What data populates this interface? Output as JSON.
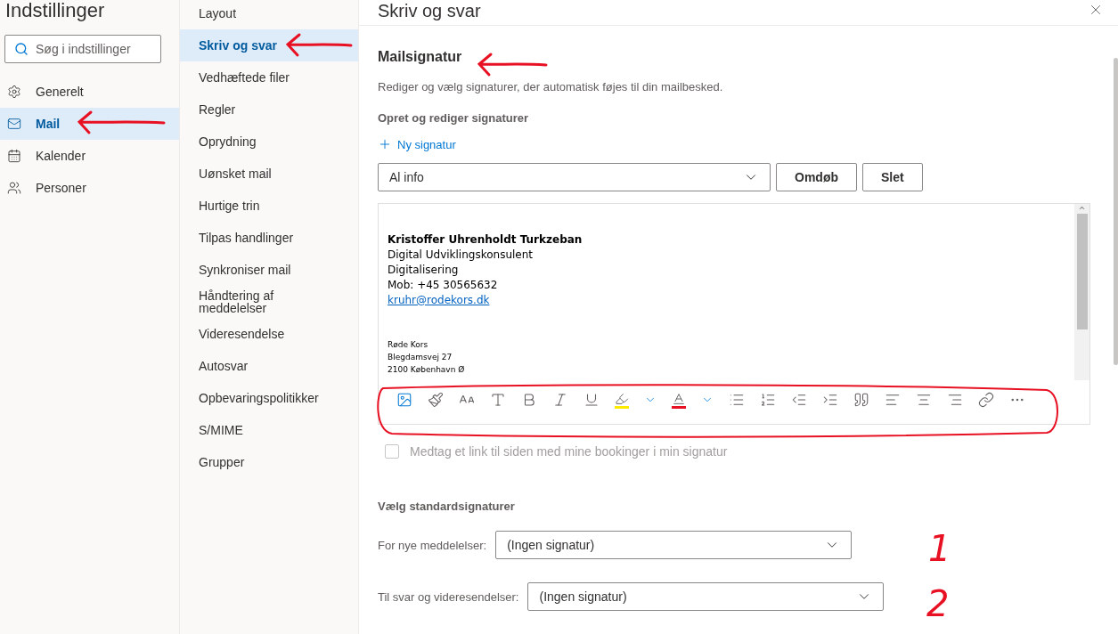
{
  "sidebar": {
    "title": "Indstillinger",
    "search": {
      "placeholder": "Søg i indstillinger"
    },
    "items": [
      {
        "label": "Generelt",
        "kind": "gear",
        "selected": false
      },
      {
        "label": "Mail",
        "kind": "mail",
        "selected": true
      },
      {
        "label": "Kalender",
        "kind": "calendar",
        "selected": false
      },
      {
        "label": "Personer",
        "kind": "people",
        "selected": false
      }
    ]
  },
  "submenu": {
    "items": [
      {
        "label": "Layout",
        "selected": false
      },
      {
        "label": "Skriv og svar",
        "selected": true
      },
      {
        "label": "Vedhæftede filer",
        "selected": false
      },
      {
        "label": "Regler",
        "selected": false
      },
      {
        "label": "Oprydning",
        "selected": false
      },
      {
        "label": "Uønsket mail",
        "selected": false
      },
      {
        "label": "Hurtige trin",
        "selected": false
      },
      {
        "label": "Tilpas handlinger",
        "selected": false
      },
      {
        "label": "Synkroniser mail",
        "selected": false
      },
      {
        "label": "Håndtering af meddelelser",
        "selected": false
      },
      {
        "label": "Videresendelse",
        "selected": false
      },
      {
        "label": "Autosvar",
        "selected": false
      },
      {
        "label": "Opbevaringspolitikker",
        "selected": false
      },
      {
        "label": "S/MIME",
        "selected": false
      },
      {
        "label": "Grupper",
        "selected": false
      }
    ]
  },
  "panel": {
    "title": "Skriv og svar",
    "section_title": "Mailsignatur",
    "description": "Rediger og vælg signaturer, der automatisk føjes til din mailbesked.",
    "subheading": "Opret og rediger signaturer",
    "new_button": "Ny signatur",
    "signature_select": "Al info",
    "buttons": [
      "Omdøb",
      "Slet"
    ],
    "signature": {
      "name": "Kristoffer Uhrenholdt Turkzeban",
      "lines": [
        "Digital Udviklingskonsulent",
        "Digitalisering",
        "Mob: +45 30565632"
      ],
      "email": "kruhr@rodekors.dk",
      "address": [
        "Røde Kors",
        "Blegdamsvej 27",
        "2100 København Ø"
      ]
    },
    "checkbox": {
      "label": "Medtag et link til siden med mine bookinger i min signatur",
      "checked": false,
      "disabled": true
    },
    "defaults_heading": "Vælg standardsignaturer",
    "defaults": [
      {
        "label": "For nye meddelelser:",
        "value": "(Ingen signatur)"
      },
      {
        "label": "Til svar og videresendelser:",
        "value": "(Ingen signatur)"
      }
    ]
  },
  "annotations": {
    "numbers": [
      "1",
      "2"
    ]
  }
}
